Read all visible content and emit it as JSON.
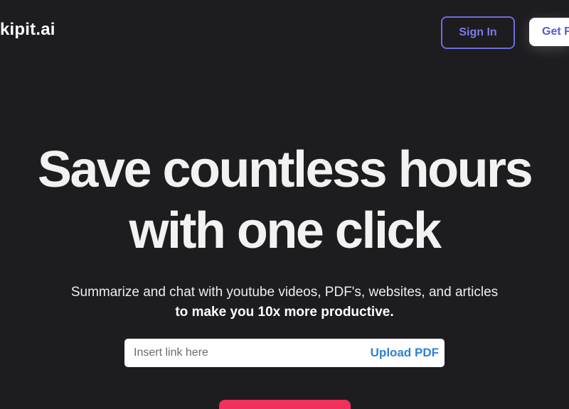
{
  "header": {
    "logo_text": "kipit.ai",
    "sign_in_label": "Sign In",
    "get_started_label": "Get F"
  },
  "hero": {
    "title_line_1": "Save countless hours",
    "title_line_2": "with one click",
    "subtitle": "Summarize and chat with youtube videos, PDF's, websites, and articles",
    "subtitle_strong": "to make you 10x more productive."
  },
  "link_bar": {
    "placeholder": "Insert link here",
    "value": "",
    "upload_label": "Upload PDF"
  },
  "colors": {
    "background": "#1d1c1f",
    "sign_in_accent": "#6f6bdc",
    "upload_link": "#2e7fd6",
    "cta": "#f0315b"
  }
}
